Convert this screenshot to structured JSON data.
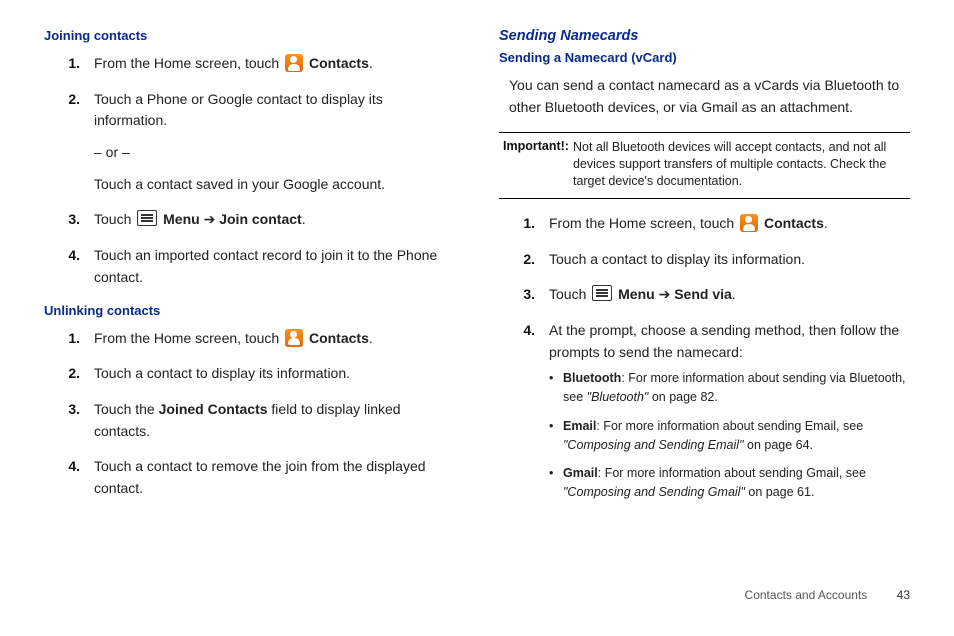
{
  "left": {
    "section1": {
      "title": "Joining contacts",
      "steps": [
        {
          "num": "1.",
          "pre": "From the Home screen, touch ",
          "icon": "contacts",
          "post_bold": "Contacts",
          "tail": "."
        },
        {
          "num": "2.",
          "text": "Touch a Phone or Google contact to display its information.",
          "sub1": "– or –",
          "sub2": "Touch a contact saved in your Google account."
        },
        {
          "num": "3.",
          "pre": "Touch ",
          "icon": "menu",
          "post_bold": "Menu",
          "arrow": " ➔ ",
          "post_bold2": "Join contact",
          "tail": "."
        },
        {
          "num": "4.",
          "text": "Touch an imported contact record to join it to the Phone contact."
        }
      ]
    },
    "section2": {
      "title": "Unlinking contacts",
      "steps": [
        {
          "num": "1.",
          "pre": "From the Home screen, touch ",
          "icon": "contacts",
          "post_bold": "Contacts",
          "tail": "."
        },
        {
          "num": "2.",
          "text": "Touch a contact to display its information."
        },
        {
          "num": "3.",
          "pre": "Touch the ",
          "post_bold": "Joined Contacts",
          "tail": " field to display linked contacts."
        },
        {
          "num": "4.",
          "text": "Touch a contact to remove the join from the displayed contact."
        }
      ]
    }
  },
  "right": {
    "heading": "Sending Namecards",
    "subheading": "Sending a Namecard (vCard)",
    "intro": "You can send a contact namecard as a vCards via Bluetooth to other Bluetooth devices, or via Gmail as an attachment.",
    "important": {
      "label": "Important!:",
      "text": "Not all Bluetooth devices will accept contacts, and not all devices support transfers of multiple contacts. Check the target device's documentation."
    },
    "steps": [
      {
        "num": "1.",
        "pre": "From the Home screen, touch ",
        "icon": "contacts",
        "post_bold": "Contacts",
        "tail": "."
      },
      {
        "num": "2.",
        "text": "Touch a contact to display its information."
      },
      {
        "num": "3.",
        "pre": "Touch ",
        "icon": "menu",
        "post_bold": "Menu",
        "arrow": " ➔ ",
        "post_bold2": "Send via",
        "tail": "."
      },
      {
        "num": "4.",
        "text": "At the prompt, choose a sending method, then follow the prompts to send the namecard:",
        "bullets": [
          {
            "b": "Bluetooth",
            "t1": ": For more information about sending via Bluetooth, see ",
            "it": "\"Bluetooth\"",
            "t2": " on page 82."
          },
          {
            "b": "Email",
            "t1": ": For more information about sending Email, see ",
            "it": "\"Composing and Sending Email\"",
            "t2": " on page 64."
          },
          {
            "b": "Gmail",
            "t1": ": For more information about sending Gmail, see ",
            "it": "\"Composing and Sending Gmail\"",
            "t2": " on page 61."
          }
        ]
      }
    ]
  },
  "footer": {
    "section": "Contacts and Accounts",
    "page": "43"
  }
}
